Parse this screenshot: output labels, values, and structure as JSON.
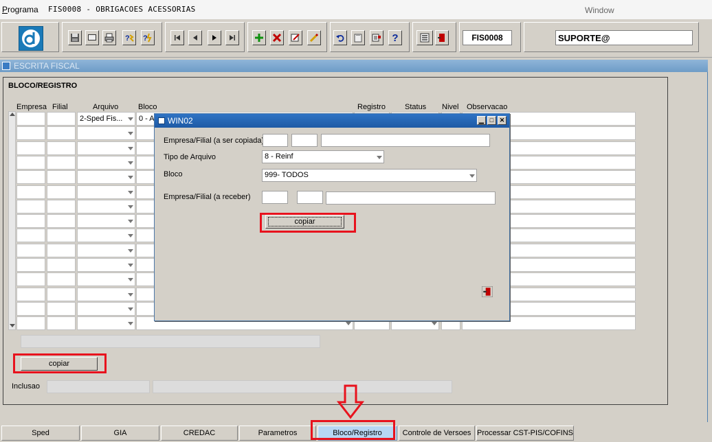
{
  "menubar": {
    "program_label": "Programa",
    "module_title": "FIS0008 - OBRIGACOES ACESSORIAS",
    "window_label": "Window"
  },
  "toolbar": {
    "program_code": "FIS0008",
    "user": "SUPORTE@",
    "icons": [
      "save-icon",
      "screen-icon",
      "print-icon",
      "help-query-icon",
      "execute-query-icon",
      "first-record-icon",
      "prev-record-icon",
      "next-record-icon",
      "last-record-icon",
      "insert-record-icon",
      "delete-record-icon",
      "edit-record-icon",
      "clear-icon",
      "undo-icon",
      "clipboard-icon",
      "list-icon",
      "help-icon",
      "menu-icon",
      "exit-icon"
    ],
    "colors": {
      "insert": "#109010",
      "delete": "#c00000",
      "help": "#0a2a9a"
    }
  },
  "main_window": {
    "title": "ESCRITA FISCAL",
    "frame_title": "BLOCO/REGISTRO",
    "columns": [
      "Empresa",
      "Filial",
      "Arquivo",
      "Bloco",
      "Registro",
      "Status",
      "Nivel",
      "Observacao"
    ],
    "first_row": {
      "arquivo": "2-Sped Fis...",
      "bloco": "0 - A"
    },
    "copy_button": "copiar",
    "inclusao_label": "Inclusao"
  },
  "dialog": {
    "title": "WIN02",
    "source_label": "Empresa/Filial (a ser copiada)",
    "file_type_label": "Tipo de Arquivo",
    "file_type_value": "8 - Reinf",
    "block_label": "Bloco",
    "block_value": "999- TODOS",
    "target_label": "Empresa/Filial (a receber)",
    "copy_button": "copiar"
  },
  "tabs": [
    {
      "label": "Sped"
    },
    {
      "label": "GIA"
    },
    {
      "label": "CREDAC"
    },
    {
      "label": "Parametros"
    },
    {
      "label": "Bloco/Registro",
      "active": true
    },
    {
      "label": "Controle de Versoes"
    },
    {
      "label": "Processar CST-PIS/COFINS"
    }
  ],
  "highlight_color": "#e8121d"
}
